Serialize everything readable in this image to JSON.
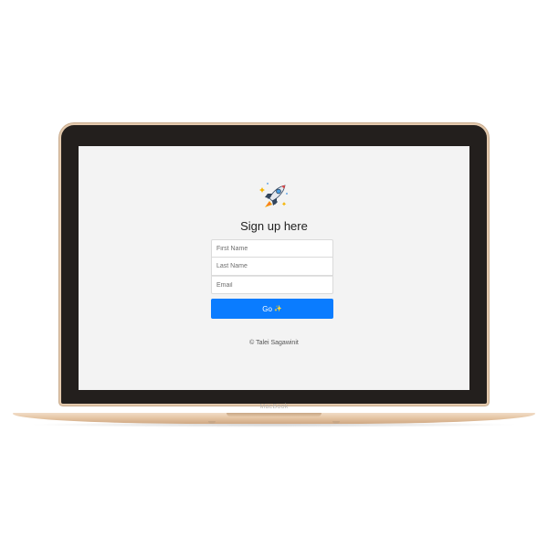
{
  "device": {
    "label": "MacBook"
  },
  "signup": {
    "logo_icon": "rocket-icon",
    "title": "Sign up here",
    "first_name_placeholder": "First Name",
    "last_name_placeholder": "Last Name",
    "email_placeholder": "Email",
    "go_label": "Go",
    "go_icon": "sparkles-icon",
    "go_icon_glyph": "✨",
    "credit": "© Talei Sagawinit"
  },
  "colors": {
    "button": "#0a7cff",
    "screen_background": "#f3f3f3",
    "frame_gold": "#e5c6a5"
  }
}
